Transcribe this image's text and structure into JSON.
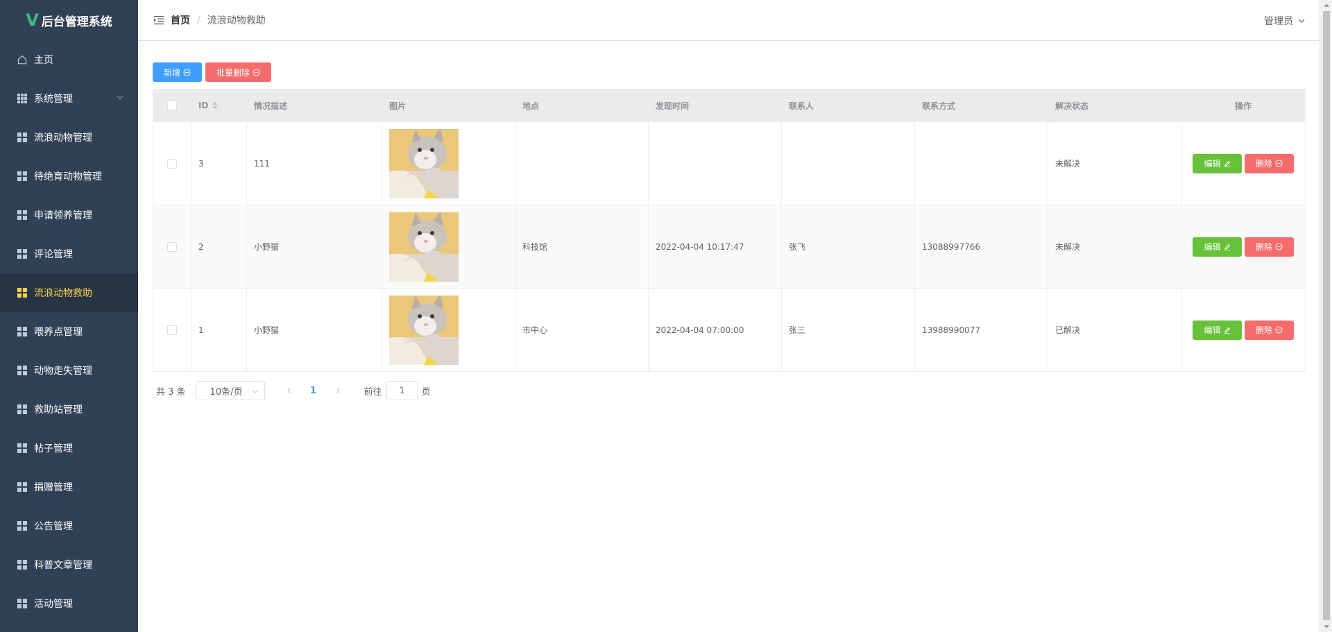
{
  "app": {
    "title": "后台管理系统",
    "logo_glyph": "V"
  },
  "sidebar": {
    "items": [
      {
        "label": "主页",
        "icon": "home-icon"
      },
      {
        "label": "系统管理",
        "icon": "grid-icon",
        "expandable": true
      },
      {
        "label": "流浪动物管理",
        "icon": "grid-icon"
      },
      {
        "label": "待绝育动物管理",
        "icon": "grid-icon"
      },
      {
        "label": "申请领养管理",
        "icon": "grid-icon"
      },
      {
        "label": "评论管理",
        "icon": "grid-icon"
      },
      {
        "label": "流浪动物救助",
        "icon": "grid-icon",
        "active": true
      },
      {
        "label": "喂养点管理",
        "icon": "grid-icon"
      },
      {
        "label": "动物走失管理",
        "icon": "grid-icon"
      },
      {
        "label": "救助站管理",
        "icon": "grid-icon"
      },
      {
        "label": "帖子管理",
        "icon": "grid-icon"
      },
      {
        "label": "捐赠管理",
        "icon": "grid-icon"
      },
      {
        "label": "公告管理",
        "icon": "grid-icon"
      },
      {
        "label": "科普文章管理",
        "icon": "grid-icon"
      },
      {
        "label": "活动管理",
        "icon": "grid-icon"
      }
    ]
  },
  "header": {
    "breadcrumb": [
      "首页",
      "流浪动物救助"
    ],
    "separator": "/",
    "user": "管理员"
  },
  "toolbar": {
    "add_label": "新增",
    "batch_delete_label": "批量删除"
  },
  "table": {
    "columns": [
      "",
      "ID",
      "情况描述",
      "图片",
      "地点",
      "发现时间",
      "联系人",
      "联系方式",
      "解决状态",
      "操作"
    ],
    "rows": [
      {
        "id": "3",
        "desc": "111",
        "location": "",
        "time": "",
        "contact": "",
        "phone": "",
        "status": "未解决"
      },
      {
        "id": "2",
        "desc": "小野猫",
        "location": "科技馆",
        "time": "2022-04-04 10:17:47",
        "contact": "张飞",
        "phone": "13088997766",
        "status": "未解决"
      },
      {
        "id": "1",
        "desc": "小野猫",
        "location": "市中心",
        "time": "2022-04-04 07:00:00",
        "contact": "张三",
        "phone": "13988990077",
        "status": "已解决"
      }
    ],
    "edit_label": "编辑",
    "delete_label": "删除"
  },
  "pagination": {
    "total_text": "共 3 条",
    "page_size": "10条/页",
    "current_page": "1",
    "goto_label": "前往",
    "goto_value": "1",
    "page_unit": "页"
  },
  "colors": {
    "sidebar_bg": "#304156",
    "sidebar_active": "#ffd04b",
    "primary": "#409eff",
    "danger": "#f56c6c",
    "success": "#67c23a"
  }
}
